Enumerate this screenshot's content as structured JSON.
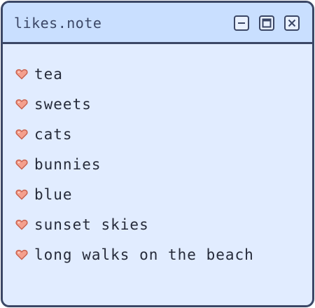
{
  "window": {
    "title": "likes.note",
    "controls": {
      "minimize_icon": "minimize-icon",
      "maximize_icon": "maximize-icon",
      "close_icon": "close-icon"
    }
  },
  "likes": [
    {
      "label": "tea"
    },
    {
      "label": "sweets"
    },
    {
      "label": "cats"
    },
    {
      "label": "bunnies"
    },
    {
      "label": "blue"
    },
    {
      "label": "sunset skies"
    },
    {
      "label": "long walks on the beach"
    }
  ],
  "colors": {
    "border": "#3b4766",
    "titlebar": "#c9dfff",
    "body": "#e1ecff",
    "heart_fill": "#f4a08e",
    "heart_outline": "#c8614e",
    "text": "#262b3a"
  },
  "icons": {
    "bullet": "heart-icon"
  }
}
